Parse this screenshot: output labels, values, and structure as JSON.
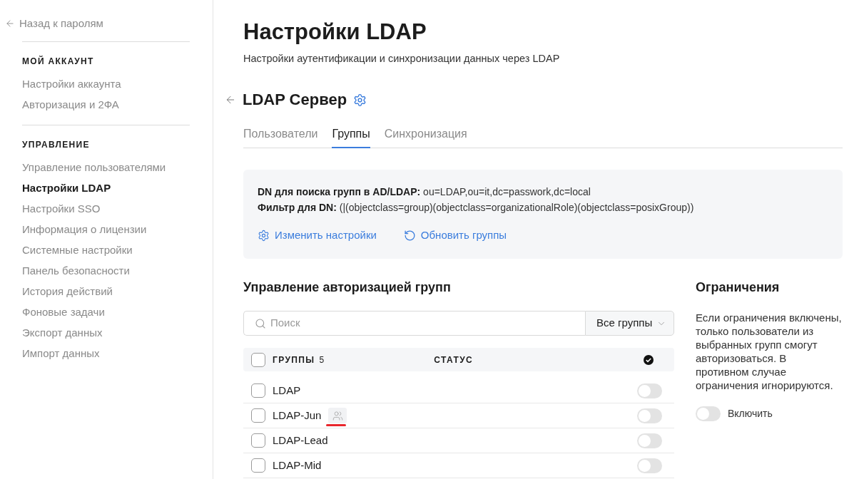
{
  "sidebar": {
    "back_link": "Назад к паролям",
    "sections": [
      {
        "title": "МОЙ АККАУНТ",
        "items": [
          {
            "label": "Настройки аккаунта",
            "selected": false
          },
          {
            "label": "Авторизация и 2ФА",
            "selected": false
          }
        ]
      },
      {
        "title": "УПРАВЛЕНИЕ",
        "items": [
          {
            "label": "Управление пользователями",
            "selected": false
          },
          {
            "label": "Настройки LDAP",
            "selected": true
          },
          {
            "label": "Настройки SSO",
            "selected": false
          },
          {
            "label": "Информация о лицензии",
            "selected": false
          },
          {
            "label": "Системные настройки",
            "selected": false
          },
          {
            "label": "Панель безопасности",
            "selected": false
          },
          {
            "label": "История действий",
            "selected": false
          },
          {
            "label": "Фоновые задачи",
            "selected": false
          },
          {
            "label": "Экспорт данных",
            "selected": false
          },
          {
            "label": "Импорт данных",
            "selected": false
          }
        ]
      }
    ]
  },
  "page": {
    "title": "Настройки LDAP",
    "subtitle": "Настройки аутентификации и синхронизации данных через LDAP"
  },
  "server": {
    "title": "LDAP Сервер"
  },
  "tabs": [
    {
      "label": "Пользователи",
      "selected": false
    },
    {
      "label": "Группы",
      "selected": true
    },
    {
      "label": "Синхронизация",
      "selected": false
    }
  ],
  "info": {
    "lines": [
      "**DN для поиска групп в AD/LDAP:** ou=LDAP,ou=it,dc=passwork,dc=local",
      "**Фильтр для DN:** (|(objectclass=group)(objectclass=organizationalRole)(objectclass=posixGroup))"
    ],
    "actions": [
      {
        "kind": "settings",
        "label": "Изменить настройки"
      },
      {
        "kind": "refresh",
        "label": "Обновить группы"
      }
    ]
  },
  "groups": {
    "title": "Управление авторизацией групп",
    "search": {
      "placeholder": "Поиск"
    },
    "filter": {
      "value": "Все группы"
    },
    "header": {
      "checked": false,
      "name_label": "ГРУППЫ",
      "count": "5",
      "status_label": "СТАТУС"
    },
    "rows": [
      {
        "name": "LDAP",
        "checked": false,
        "on": false,
        "members_icon": false,
        "marked": false
      },
      {
        "name": "LDAP-Jun",
        "checked": false,
        "on": false,
        "members_icon": true,
        "marked": true
      },
      {
        "name": "LDAP-Lead",
        "checked": false,
        "on": false,
        "members_icon": false,
        "marked": false
      },
      {
        "name": "LDAP-Mid",
        "checked": false,
        "on": false,
        "members_icon": false,
        "marked": false
      }
    ]
  },
  "restrictions": {
    "title": "Ограничения",
    "text": "Если ограничения включены, только пользователи из выбранных групп смогут авторизоваться. В противном случае ограничения игнорируются.",
    "toggle": {
      "label": "Включить",
      "on": false
    }
  }
}
